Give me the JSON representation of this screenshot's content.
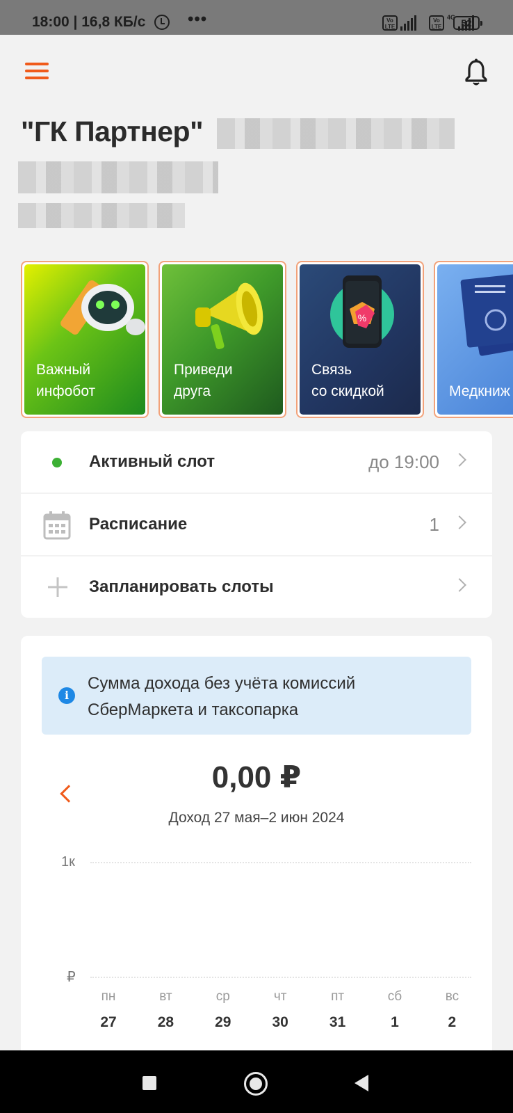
{
  "status_bar": {
    "time_speed": "18:00 | 16,8 КБ/с",
    "dots": "•••",
    "volte_1": "Vo LTE",
    "volte_2": "Vo LTE",
    "network": "4G",
    "battery": "52"
  },
  "header": {
    "company_name": "\"ГК Партнер\""
  },
  "promos": [
    {
      "label": "Важный\nинфобот"
    },
    {
      "label": "Приведи\nдруга"
    },
    {
      "label": "Связь\nсо скидкой"
    },
    {
      "label": "Медкниж"
    }
  ],
  "rows": {
    "active_slot": {
      "title": "Активный слот",
      "value": "до 19:00"
    },
    "schedule": {
      "title": "Расписание",
      "value": "1"
    },
    "plan_slots": {
      "title": "Запланировать слоты"
    }
  },
  "income": {
    "notice": "Сумма дохода без учёта комиссий СберМаркета и таксопарка",
    "amount": "0,00 ₽",
    "period": "Доход 27 мая–2 июн 2024"
  },
  "chart_data": {
    "type": "bar",
    "categories": [
      "пн 27",
      "вт 28",
      "ср 29",
      "чт 30",
      "пт 31",
      "сб 1",
      "вс 2"
    ],
    "values": [
      0,
      0,
      0,
      0,
      0,
      0,
      0
    ],
    "y_tick_labels": [
      "1к",
      "₽"
    ],
    "ylim": [
      0,
      1000
    ],
    "days": [
      {
        "name": "пн",
        "date": "27"
      },
      {
        "name": "вт",
        "date": "28"
      },
      {
        "name": "ср",
        "date": "29"
      },
      {
        "name": "чт",
        "date": "30"
      },
      {
        "name": "пт",
        "date": "31"
      },
      {
        "name": "сб",
        "date": "1"
      },
      {
        "name": "вс",
        "date": "2"
      }
    ]
  },
  "colors": {
    "accent": "#f05a1a",
    "status_green": "#3cb034",
    "info_blue": "#1e88e5"
  },
  "icons": [
    "hamburger-icon",
    "bell-icon",
    "calendar-icon",
    "plus-icon",
    "info-icon",
    "chevron-right-icon",
    "chevron-left-icon"
  ]
}
